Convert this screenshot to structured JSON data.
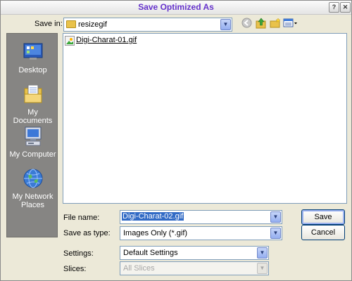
{
  "window": {
    "title": "Save Optimized As",
    "help_label": "?",
    "close_label": "✕"
  },
  "toolbar": {
    "save_in_label": "Save in:",
    "save_in_value": "resizegif",
    "back_icon": "back-icon",
    "up_icon": "up-folder-icon",
    "new_folder_icon": "new-folder-icon",
    "views_icon": "views-menu-icon"
  },
  "places": [
    {
      "label": "Desktop",
      "icon": "desktop-icon"
    },
    {
      "label": "My Documents",
      "icon": "my-documents-icon"
    },
    {
      "label": "My Computer",
      "icon": "my-computer-icon"
    },
    {
      "label": "My Network Places",
      "icon": "network-places-icon"
    }
  ],
  "files": [
    {
      "name": "Digi-Charat-01.gif",
      "icon": "gif-file-icon"
    }
  ],
  "form": {
    "filename_label": "File name:",
    "filename_value": "Digi-Charat-02.gif",
    "savetype_label": "Save as type:",
    "savetype_value": "Images Only (*.gif)",
    "settings_label": "Settings:",
    "settings_value": "Default Settings",
    "slices_label": "Slices:",
    "slices_value": "All Slices"
  },
  "buttons": {
    "save": "Save",
    "cancel": "Cancel"
  },
  "colors": {
    "title": "#6633cc",
    "places_bg": "#868583",
    "selection": "#316ac5"
  }
}
